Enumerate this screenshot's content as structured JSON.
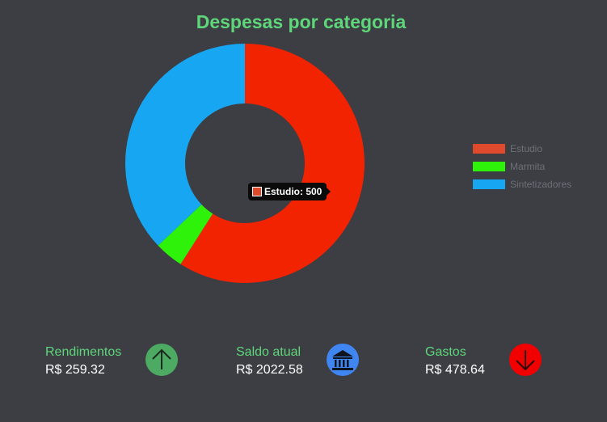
{
  "chart_data": {
    "type": "pie",
    "title": "Despesas por categoria",
    "categories": [
      "Estudio",
      "Marmita",
      "Sintetizadores"
    ],
    "values": [
      500,
      33,
      314
    ],
    "colors": [
      "#f22300",
      "#2ef20a",
      "#17a7f2"
    ],
    "legend_colors": [
      "#e04a2c",
      "#2ef20a",
      "#17a7f2"
    ],
    "legend_position": "right",
    "grid": false
  },
  "tooltip": {
    "text": "Estudio: 500",
    "color": "#e04a2c"
  },
  "summary": {
    "income": {
      "label": "Rendimentos",
      "value": "R$ 259.32",
      "icon": "arrow-up-icon",
      "color": "#4caa62"
    },
    "balance": {
      "label": "Saldo atual",
      "value": "R$ 2022.58",
      "icon": "bank-icon",
      "color": "#3f86f2"
    },
    "expenses": {
      "label": "Gastos",
      "value": "R$ 478.64",
      "icon": "arrow-down-icon",
      "color": "#f20000"
    }
  }
}
